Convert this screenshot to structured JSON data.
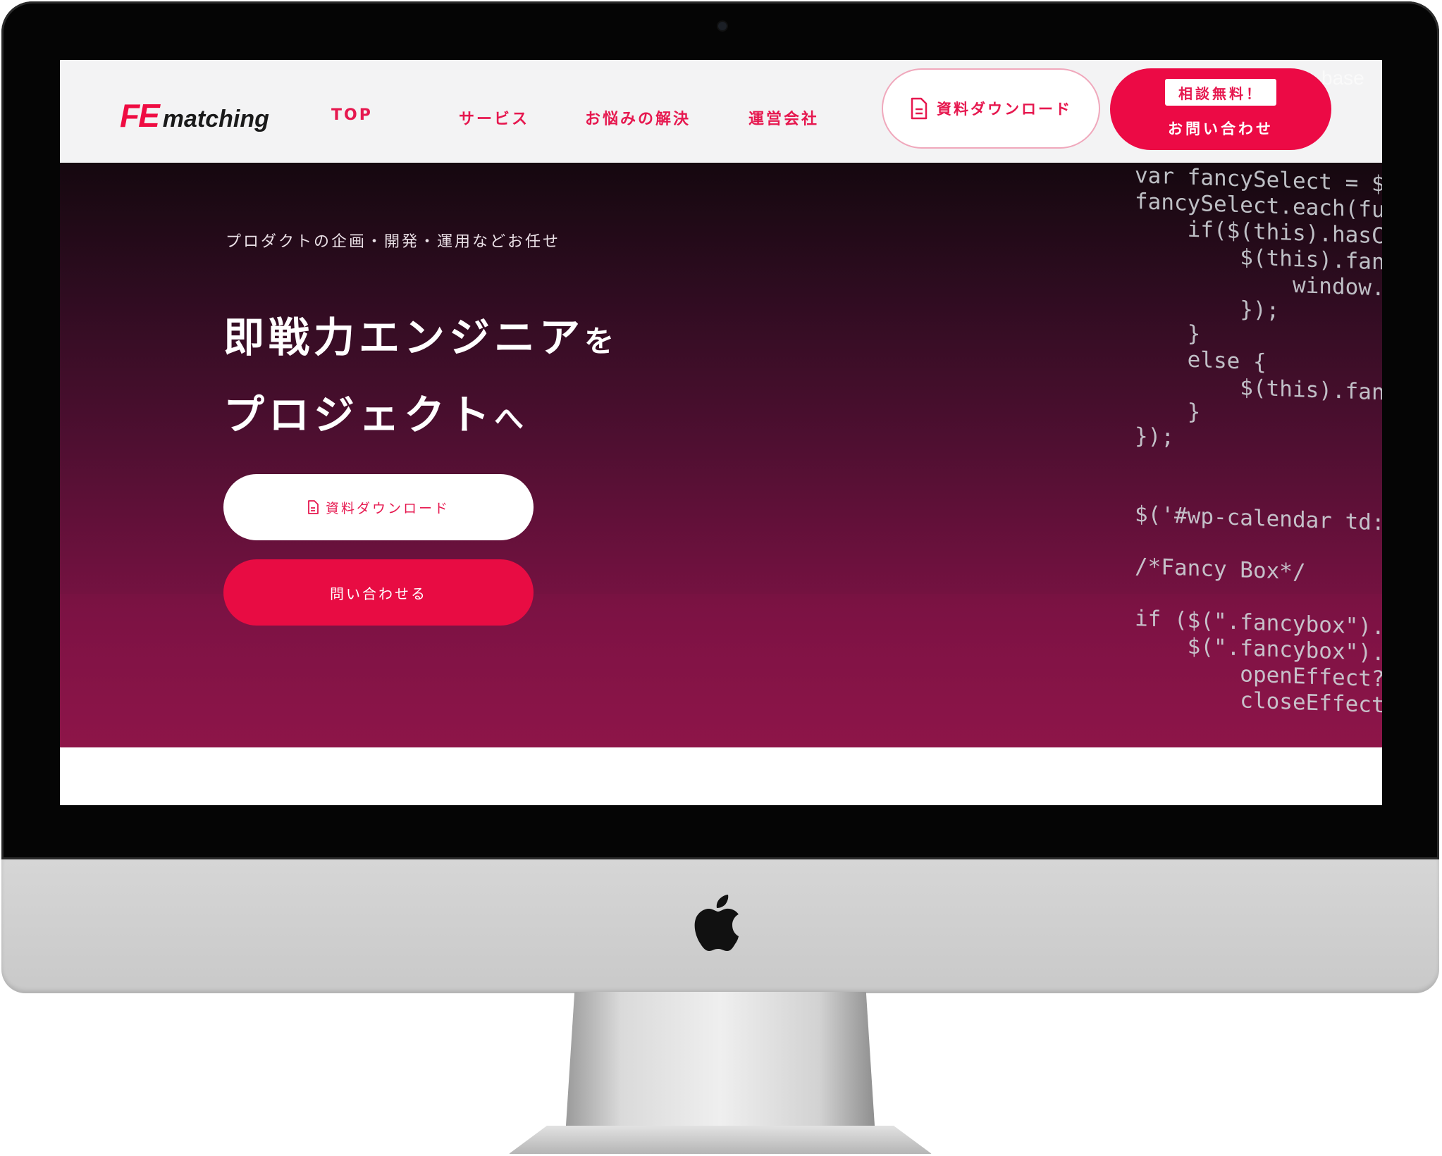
{
  "header": {
    "logo": {
      "fe": "FE",
      "matching": "matching"
    },
    "nav": [
      {
        "label": "TOP"
      },
      {
        "label": "サービス"
      },
      {
        "label": "お悩みの解決"
      },
      {
        "label": "運営会社"
      }
    ],
    "download_button": "資料ダウンロード",
    "contact_badge": "相談無料！",
    "contact_button": "お問い合わせ",
    "overlay_text": "base"
  },
  "hero": {
    "tagline": "プロダクトの企画・開発・運用などお任せ",
    "title_line1_main": "即戦力エンジニア",
    "title_line1_particle": "を",
    "title_line2_main": "プロジェクト",
    "title_line2_particle": "へ",
    "download_button": "資料ダウンロード",
    "contact_button": "問い合わせる",
    "code_lines": [
      "var fancySelect = $(",
      "fancySelect.each(fun",
      "    if($(this).hasCl",
      "        $(this).fanc",
      "            window.l",
      "        });",
      "    }",
      "    else {",
      "        $(this).fanc",
      "    }",
      "});",
      "",
      "",
      "$('#wp-calendar td:n",
      "",
      "/*Fancy Box*/",
      "",
      "if ($(\".fancybox\").l",
      "    $(\".fancybox\").f",
      "        openEffect??",
      "        closeEffect?"
    ]
  },
  "colors": {
    "brand": "#ec0a45",
    "hero_top": "#15080f",
    "hero_bottom": "#8d1548",
    "header_bg": "#f3f3f4"
  },
  "icons": [
    "document-icon",
    "apple-logo-icon",
    "camera-icon"
  ]
}
